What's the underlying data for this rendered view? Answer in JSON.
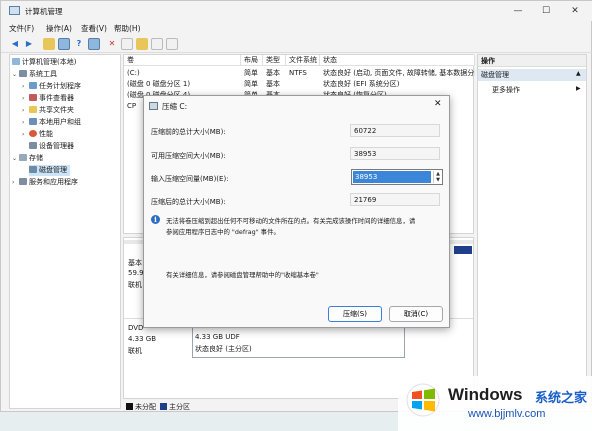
{
  "window": {
    "title": "计算机管理",
    "controls": [
      "—",
      "☐",
      "✕"
    ]
  },
  "menu": [
    "文件(F)",
    "操作(A)",
    "查看(V)",
    "帮助(H)"
  ],
  "tree": {
    "root": "计算机管理(本地)",
    "system_tools": "系统工具",
    "task_scheduler": "任务计划程序",
    "event_viewer": "事件查看器",
    "shared_folders": "共享文件夹",
    "local_users": "本地用户和组",
    "performance": "性能",
    "device_manager": "设备管理器",
    "storage": "存储",
    "disk_management": "磁盘管理",
    "services": "服务和应用程序"
  },
  "volumes": {
    "headers": [
      "卷",
      "布局",
      "类型",
      "文件系统",
      "状态"
    ],
    "rows": [
      [
        "(C:)",
        "简单",
        "基本",
        "NTFS",
        "状态良好 (启动, 页面文件, 故障转储, 基本数据分区)"
      ],
      [
        "(磁盘 0 磁盘分区 1)",
        "简单",
        "基本",
        "",
        "状态良好 (EFI 系统分区)"
      ],
      [
        "(磁盘 0 磁盘分区 4)",
        "简单",
        "基本",
        "",
        "状态良好 (恢复分区)"
      ],
      [
        "CP",
        "",
        "",
        "",
        ""
      ]
    ]
  },
  "diskmap": {
    "disk0_label": "基本",
    "disk0_size": "59.9",
    "disk0_status": "联机",
    "cd_label": "DVD",
    "cd_size": "4.33 GB",
    "cd_status": "联机",
    "cd_part_size": "4.33 GB UDF",
    "cd_part_status": "状态良好 (主分区)"
  },
  "legend": {
    "unallocated": "未分配",
    "primary": "主分区"
  },
  "actions": {
    "header": "操作",
    "section": "磁盘管理",
    "more": "更多操作"
  },
  "dialog": {
    "title": "压缩 C:",
    "total_before_label": "压缩前的总计大小(MB):",
    "total_before_value": "60722",
    "available_label": "可用压缩空间大小(MB):",
    "available_value": "38953",
    "input_label": "输入压缩空间量(MB)(E):",
    "input_value": "38953",
    "total_after_label": "压缩后的总计大小(MB):",
    "total_after_value": "21769",
    "info_text_1": "无法将卷压缩到超出任何不可移动的文件所在的点。有关完成该操作时间的详细信息，请",
    "info_text_2": "参阅应用程序日志中的 \"defrag\" 事件。",
    "help_text": "有关详细信息，请参阅磁盘管理帮助中的\"收缩基本卷\"",
    "shrink_button": "压缩(S)",
    "cancel_button": "取消(C)"
  },
  "watermark": {
    "brand": "Windows",
    "brand_cn": "系统之家",
    "url": "www.bjjmlv.com"
  }
}
